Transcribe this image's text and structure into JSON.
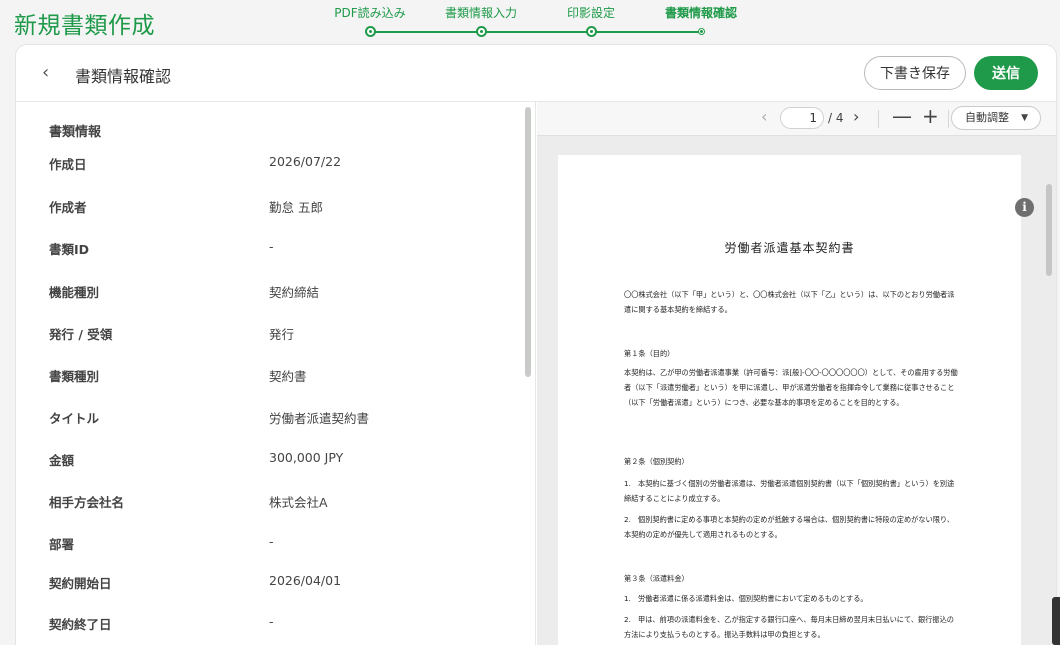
{
  "app": {
    "title": "新規書類作成"
  },
  "stepper": {
    "steps": [
      {
        "label": "PDF読み込み"
      },
      {
        "label": "書類情報入力"
      },
      {
        "label": "印影設定"
      },
      {
        "label": "書類情報確認"
      }
    ]
  },
  "header": {
    "back_icon": "chevron-left-icon",
    "title": "書類情報確認",
    "draft_label": "下書き保存",
    "send_label": "送信",
    "accent_color": "#1f9a4a"
  },
  "doc_info": {
    "section_title": "書類情報",
    "fields": [
      {
        "label": "作成日",
        "value": "2026/07/22"
      },
      {
        "label": "作成者",
        "value": "勤怠 五郎"
      },
      {
        "label": "書類ID",
        "value": "-"
      },
      {
        "label": "機能種別",
        "value": "契約締結"
      },
      {
        "label": "発行 / 受領",
        "value": "発行"
      },
      {
        "label": "書類種別",
        "value": "契約書"
      },
      {
        "label": "タイトル",
        "value": "労働者派遣契約書"
      },
      {
        "label": "金額",
        "value": "300,000 JPY"
      },
      {
        "label": "相手方会社名",
        "value": "株式会社A"
      },
      {
        "label": "部署",
        "value": "-"
      },
      {
        "label": "契約開始日",
        "value": "2026/04/01"
      },
      {
        "label": "契約終了日",
        "value": "-"
      }
    ]
  },
  "viewer": {
    "prev_icon": "‹",
    "next_icon": "›",
    "current_page": "1",
    "total_pages": "/ 4",
    "zoom_out": "—",
    "zoom_in": "+",
    "zoom_label": "自動調整",
    "zoom_caret": "▼",
    "info_icon": "i"
  },
  "document": {
    "title": "労働者派遣基本契約書",
    "preamble": "〇〇株式会社（以下「甲」という）と、〇〇株式会社（以下「乙」という）は、以下のとおり労働者派遣に関する基本契約を締結する。",
    "article1_heading": "第１条（目的）",
    "article1_body": "本契約は、乙が甲の労働者派遣事業（許可番号：派[般]-〇〇-〇〇〇〇〇〇）として、その雇用する労働者（以下「派遣労働者」という）を甲に派遣し、甲が派遣労働者を指揮命令して業務に従事させること（以下「労働者派遣」という）につき、必要な基本的事項を定めることを目的とする。",
    "article2_heading": "第２条（個別契約）",
    "article2_item1": "1.　本契約に基づく個別の労働者派遣は、労働者派遣個別契約書（以下「個別契約書」という）を別途締結することにより成立する。",
    "article2_item2": "2.　個別契約書に定める事項と本契約の定めが抵触する場合は、個別契約書に特段の定めがない限り、本契約の定めが優先して適用されるものとする。",
    "article3_heading": "第３条（派遣料金）",
    "article3_item1": "1.　労働者派遣に係る派遣料金は、個別契約書において定めるものとする。",
    "article3_item2": "2.　甲は、前項の派遣料金を、乙が指定する銀行口座へ、毎月末日締め翌月末日払いにて、銀行振込の方法により支払うものとする。振込手数料は甲の負担とする。"
  }
}
